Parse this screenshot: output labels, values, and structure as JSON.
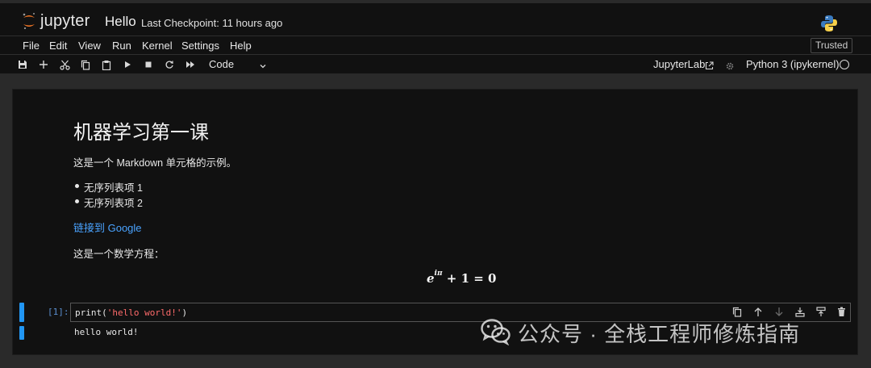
{
  "header": {
    "logo_text": "jupyter",
    "notebook_title": "Hello",
    "checkpoint": "Last Checkpoint: 11 hours ago"
  },
  "menubar": {
    "items": [
      "File",
      "Edit",
      "View",
      "Run",
      "Kernel",
      "Settings",
      "Help"
    ],
    "trusted": "Trusted"
  },
  "toolbar": {
    "buttons": [
      "save-icon",
      "add-cell-icon",
      "cut-icon",
      "copy-icon",
      "paste-icon",
      "run-icon",
      "stop-icon",
      "restart-icon",
      "fast-forward-icon"
    ],
    "cell_type": "Code",
    "jupyterlab_label": "JupyterLab",
    "kernel_name": "Python 3 (ipykernel)"
  },
  "markdown_cell": {
    "heading": "机器学习第一课",
    "intro": "这是一个 Markdown 单元格的示例。",
    "list_items": [
      "无序列表项 1",
      "无序列表项 2"
    ],
    "link_text": "链接到 Google",
    "equation_intro": "这是一个数学方程：",
    "equation": "e^{iπ} + 1 = 0"
  },
  "code_cell": {
    "prompt": "[1]:",
    "code_prefix": "print(",
    "code_string": "'hello world!'",
    "code_suffix": ")",
    "tools": [
      "duplicate-icon",
      "move-up-icon",
      "move-down-icon",
      "insert-above-icon",
      "insert-below-icon",
      "delete-icon"
    ],
    "output": "hello world!"
  },
  "watermark": {
    "text": "公众号 · 全栈工程师修炼指南"
  },
  "colors": {
    "accent": "#2196f3",
    "link": "#4aa3ff",
    "string": "#ff6b6b",
    "jupyter_orange": "#f37726"
  }
}
